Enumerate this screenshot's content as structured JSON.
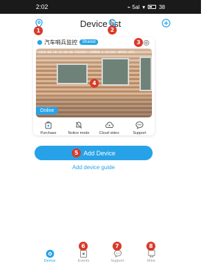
{
  "status_bar": {
    "time": "2:02",
    "signal": "⌁ 5al",
    "wifi": "▾",
    "battery": "38"
  },
  "header": {
    "title": "Device list"
  },
  "device": {
    "name": "汽车哨兵监控",
    "shared_label": "Shared",
    "osd_text": "2019-08-18 14:00:00 TUESDAY CAMERA 1 A1(24) ONTAC  GPS",
    "status": "Online",
    "actions": [
      {
        "label": "Purchase",
        "icon": "purchase-icon"
      },
      {
        "label": "Notice mode",
        "icon": "notice-icon"
      },
      {
        "label": "Cloud video",
        "icon": "cloud-icon"
      },
      {
        "label": "Support",
        "icon": "chat-icon"
      }
    ]
  },
  "add_device": {
    "label": "Add Device"
  },
  "guide": {
    "label": "Add device guide"
  },
  "tabs": [
    {
      "label": "Device",
      "icon": "device-icon",
      "active": true
    },
    {
      "label": "Events",
      "icon": "events-icon",
      "active": false
    },
    {
      "label": "Support",
      "icon": "support-icon",
      "active": false
    },
    {
      "label": "Mine",
      "icon": "mine-icon",
      "active": false
    }
  ],
  "badges": [
    "1",
    "2",
    "3",
    "4",
    "5",
    "6",
    "7",
    "8"
  ],
  "colors": {
    "accent": "#27a2e8",
    "badge": "#d93a2a"
  }
}
